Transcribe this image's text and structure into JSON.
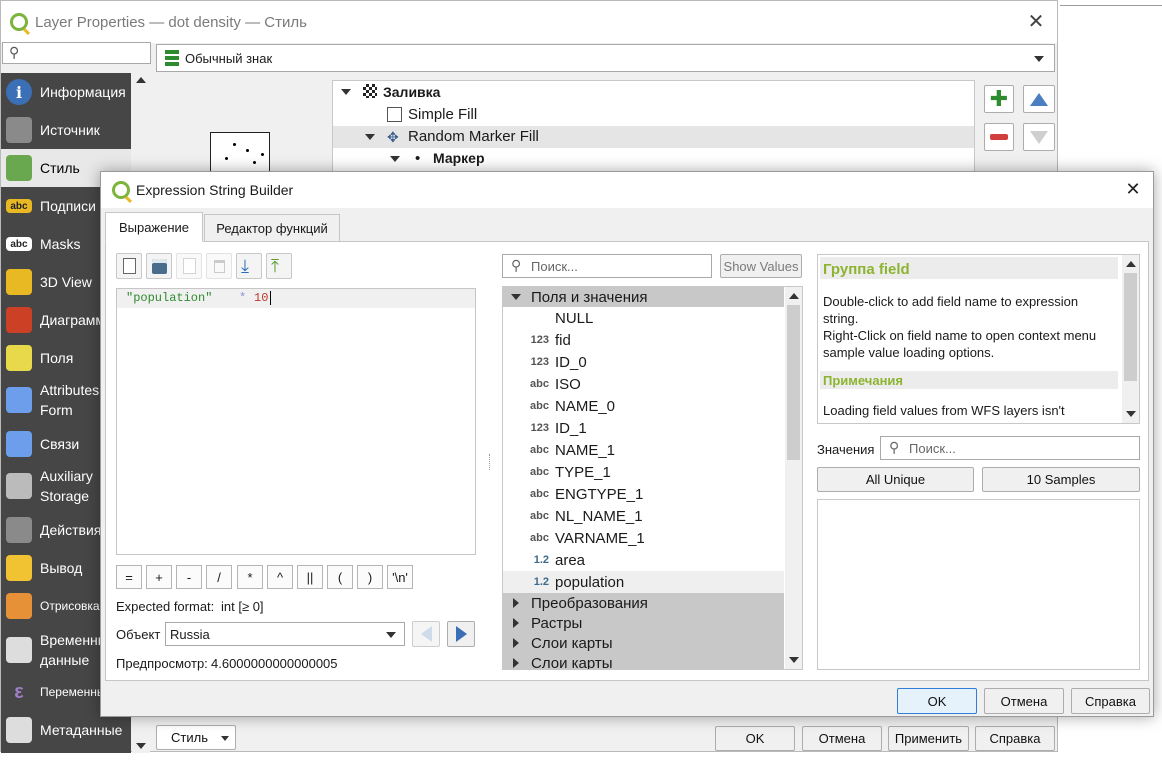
{
  "layer_props": {
    "title": "Layer Properties — dot density — Стиль",
    "renderer": "Обычный знак",
    "sidebar": [
      {
        "label": "Информация",
        "icon": "info-icon",
        "color": "#3b6fb6"
      },
      {
        "label": "Источник",
        "icon": "source-wrench-icon",
        "color": "#8a8a8a"
      },
      {
        "label": "Стиль",
        "icon": "style-brush-icon",
        "color": "#6aa84f"
      },
      {
        "label": "Подписи",
        "icon": "labels-abc-icon",
        "color": "#e8b923"
      },
      {
        "label": "Masks",
        "icon": "masks-abc-icon",
        "color": "#ffffff"
      },
      {
        "label": "3D View",
        "icon": "3d-cube-icon",
        "color": "#e8b923"
      },
      {
        "label": "Диаграммы",
        "icon": "diagram-icon",
        "color": "#cc4125"
      },
      {
        "label": "Поля",
        "icon": "fields-table-icon",
        "color": "#e8d94a"
      },
      {
        "label": "Attributes Form",
        "icon": "attributes-form-icon",
        "color": "#6d9eeb"
      },
      {
        "label": "Связи",
        "icon": "joins-icon",
        "color": "#6d9eeb"
      },
      {
        "label": "Auxiliary Storage",
        "icon": "auxiliary-storage-icon",
        "color": "#bbbbbb"
      },
      {
        "label": "Действия",
        "icon": "actions-gear-icon",
        "color": "#8a8a8a"
      },
      {
        "label": "Вывод",
        "icon": "display-tooltip-icon",
        "color": "#f1c232"
      },
      {
        "label": "Отрисовка",
        "icon": "rendering-brush-icon",
        "color": "#e69138"
      },
      {
        "label": "Временные данные",
        "icon": "temporal-clock-icon",
        "color": "#dddddd"
      },
      {
        "label": "Переменные",
        "icon": "variables-epsilon-icon",
        "color": "#9e7ec7"
      },
      {
        "label": "Метаданные",
        "icon": "metadata-icon",
        "color": "#dddddd"
      }
    ],
    "tree": {
      "fill": "Заливка",
      "simple_fill": "Simple Fill",
      "random_marker_fill": "Random Marker Fill",
      "marker": "Маркер"
    },
    "bottom": {
      "style_btn": "Стиль",
      "ok": "OK",
      "cancel": "Отмена",
      "apply": "Применить",
      "help": "Справка"
    }
  },
  "expr_dialog": {
    "title": "Expression String Builder",
    "tabs": [
      "Выражение",
      "Редактор функций"
    ],
    "expression": {
      "field": "\"population\"",
      "op": "*",
      "num": "10"
    },
    "operators": [
      "=",
      "+",
      "-",
      "/",
      "*",
      "^",
      "||",
      "(",
      ")",
      "'\\n'"
    ],
    "expected_label": "Expected format:",
    "expected_value": "int [≥ 0]",
    "object_label": "Объект",
    "object_value": "Russia",
    "preview_label": "Предпросмотр:",
    "preview_value": "4.6000000000000005",
    "search_placeholder": "Поиск...",
    "show_values": "Show Values",
    "group_fields": "Поля и значения",
    "fields": [
      {
        "type": "",
        "name": "NULL"
      },
      {
        "type": "123",
        "name": "fid"
      },
      {
        "type": "123",
        "name": "ID_0"
      },
      {
        "type": "abc",
        "name": "ISO"
      },
      {
        "type": "abc",
        "name": "NAME_0"
      },
      {
        "type": "123",
        "name": "ID_1"
      },
      {
        "type": "abc",
        "name": "NAME_1"
      },
      {
        "type": "abc",
        "name": "TYPE_1"
      },
      {
        "type": "abc",
        "name": "ENGTYPE_1"
      },
      {
        "type": "abc",
        "name": "NL_NAME_1"
      },
      {
        "type": "abc",
        "name": "VARNAME_1"
      },
      {
        "type": "1.2",
        "name": "area"
      },
      {
        "type": "1.2",
        "name": "population"
      }
    ],
    "groups": [
      "Преобразования",
      "Растры",
      "Слои карты",
      "Слои карты"
    ],
    "help": {
      "heading": "Группа field",
      "text1": "Double-click to add field name to expression string.",
      "text2": "Right-Click on field name to open context menu sample value loading options.",
      "notes_heading": "Примечания",
      "notes_text": "Loading field values from WFS layers isn't"
    },
    "values_label": "Значения",
    "values_placeholder": "Поиск...",
    "all_unique": "All Unique",
    "samples": "10 Samples",
    "ok": "OK",
    "cancel": "Отмена",
    "help_btn": "Справка"
  },
  "colors": {
    "accent_green": "#8db431",
    "sidebar_bg": "#464646",
    "group_bg": "#c8c8c8",
    "expr_field": "#2e8b2e",
    "expr_op": "#8d8dd4",
    "expr_num": "#c0392b"
  }
}
